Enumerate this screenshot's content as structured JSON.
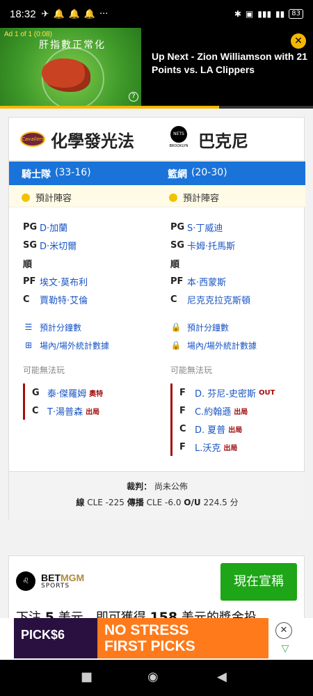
{
  "status_bar": {
    "time": "18:32",
    "battery": "83"
  },
  "ad_top": {
    "label": "Ad 1 of 1 (0:08)",
    "headline": "肝指數正常化",
    "up_next": "Up Next - Zion Williamson with 21 Points vs. LA Clippers",
    "progress": 0.7
  },
  "matchup": {
    "home": {
      "name": "化學發光法",
      "logo_text": "Cavaliers",
      "team_label": "騎士隊",
      "record": "(33-16)",
      "lineup_status": "預計陣容",
      "lineup": [
        {
          "pos": "PG",
          "player": "D·加蘭"
        },
        {
          "pos": "SG",
          "player": "D·米切爾"
        },
        {
          "pos": "順",
          "player": ""
        },
        {
          "pos": "PF",
          "player": "埃文·莫布利"
        },
        {
          "pos": "C",
          "player": "賈勒特·艾倫"
        }
      ],
      "links": [
        "預計分鐘數",
        "場內/場外統計數據"
      ],
      "may_not_play_label": "可能無法玩",
      "injuries": [
        {
          "pos": "G",
          "player": "泰·傑羅姆",
          "status": "奧特"
        },
        {
          "pos": "C",
          "player": "T·湯普森",
          "status": "出局"
        }
      ]
    },
    "away": {
      "name": "巴克尼",
      "logo_text": "NETS",
      "logo_sub": "BROOKLYN",
      "team_label": "籃網",
      "record": "(20-30)",
      "lineup_status": "預計陣容",
      "lineup": [
        {
          "pos": "PG",
          "player": "S·丁威迪"
        },
        {
          "pos": "SG",
          "player": "卡姆·托馬斯"
        },
        {
          "pos": "順",
          "player": ""
        },
        {
          "pos": "PF",
          "player": "本·西蒙斯"
        },
        {
          "pos": "C",
          "player": "尼克克拉克斯頓"
        }
      ],
      "links": [
        "預計分鐘數",
        "場內/場外統計數據"
      ],
      "may_not_play_label": "可能無法玩",
      "injuries": [
        {
          "pos": "F",
          "player": "D. 芬尼-史密斯",
          "status": "OUT"
        },
        {
          "pos": "F",
          "player": "C.約翰遜",
          "status": "出局"
        },
        {
          "pos": "C",
          "player": "D. 夏普",
          "status": "出局"
        },
        {
          "pos": "F",
          "player": "L.沃克",
          "status": "出局"
        }
      ]
    },
    "footer": {
      "referee_label": "裁判：",
      "referee_value": "尚未公佈",
      "line_label": "線",
      "line_value": "CLE -225",
      "spread_label": "傳播",
      "spread_value": "CLE -6.0",
      "ou_label": "O/U",
      "ou_value": "224.5 分"
    }
  },
  "betmgm": {
    "brand_a": "BET",
    "brand_b": "MGM",
    "sports": "SPORTS",
    "button": "現在宣稱",
    "promo_a": "下注",
    "promo_amt1": "5",
    "promo_b": "美元，即可獲得",
    "promo_amt2": "158",
    "promo_c": "美元的獎金投"
  },
  "ad_bottom": {
    "logo": "PICK$6",
    "line1": "NO STRESS",
    "line2": "FIRST PICKS"
  },
  "colors": {
    "accent_blue": "#1a73d9",
    "link_blue": "#1a56c4",
    "injury_red": "#a40d0d",
    "bet_green": "#1ea518"
  }
}
